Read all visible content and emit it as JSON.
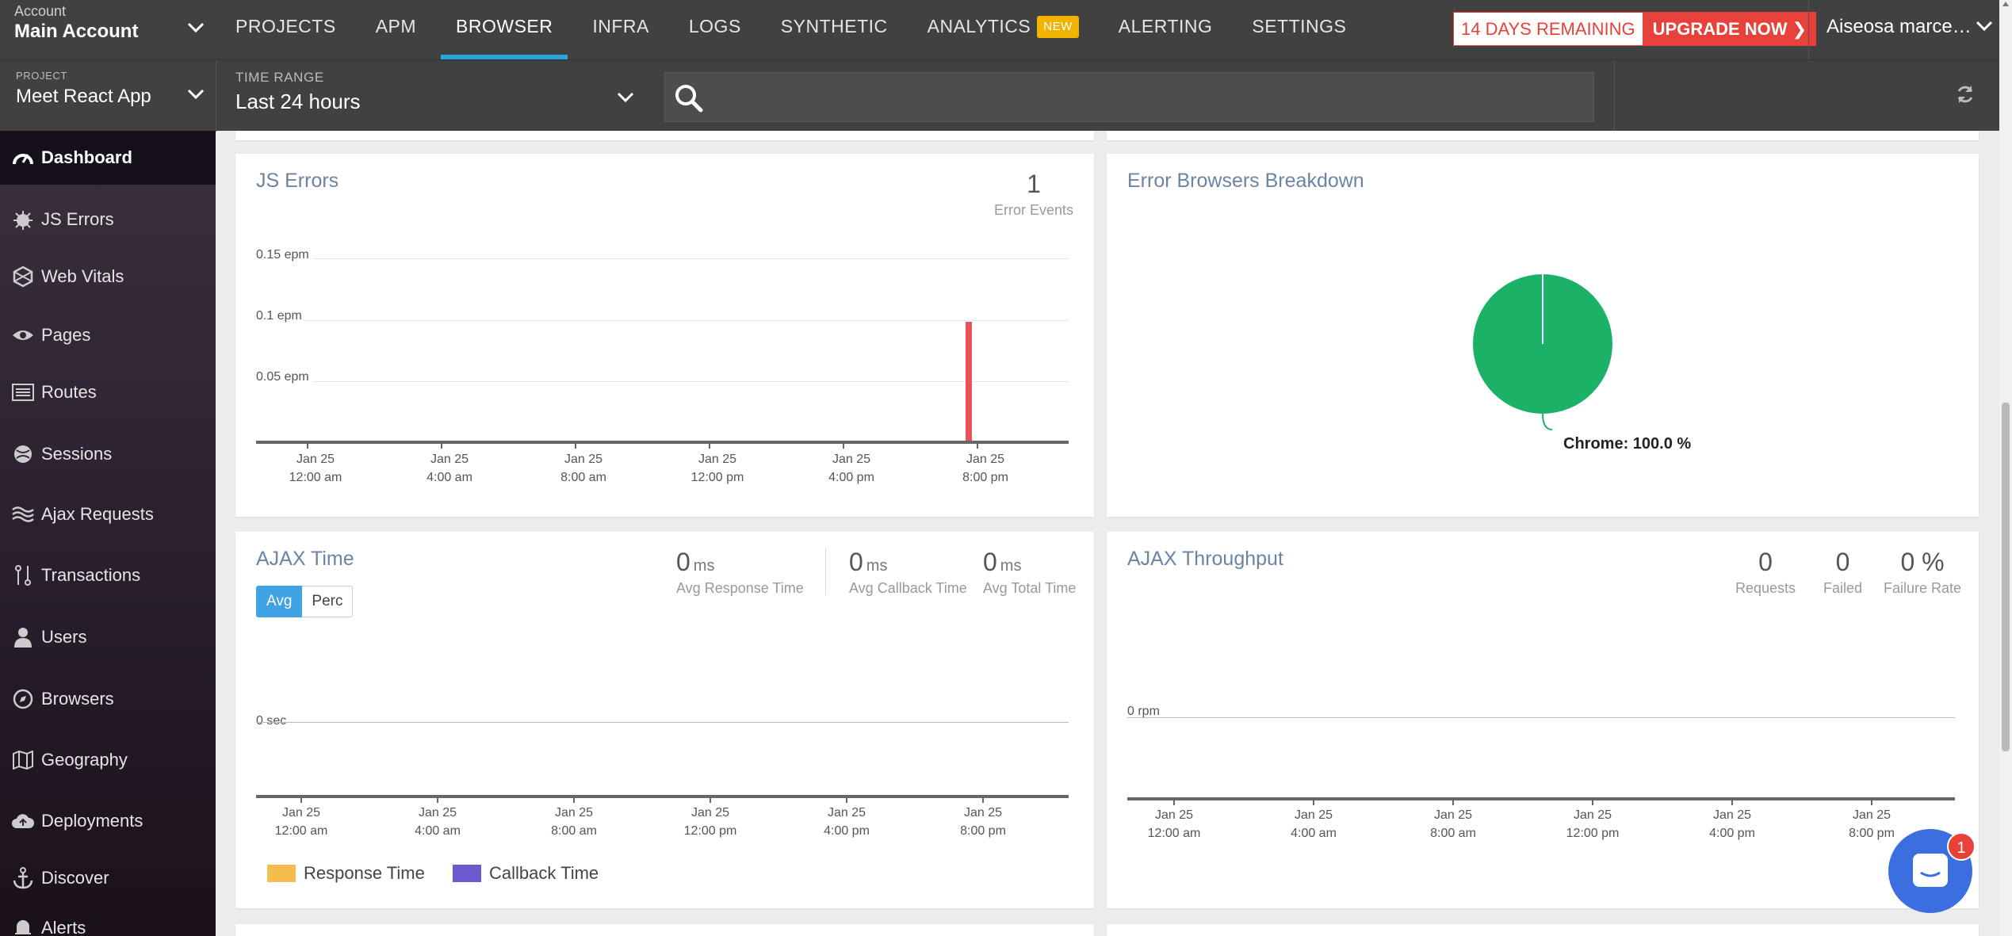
{
  "header": {
    "account_label": "Account",
    "account_name": "Main Account",
    "nav": [
      "PROJECTS",
      "APM",
      "BROWSER",
      "INFRA",
      "LOGS",
      "SYNTHETIC",
      "ANALYTICS",
      "ALERTING",
      "SETTINGS"
    ],
    "analytics_badge": "NEW",
    "trial_text": "14 DAYS REMAINING",
    "upgrade_text": "UPGRADE NOW",
    "user_name": "Aiseosa marce…"
  },
  "subbar": {
    "project_label": "PROJECT",
    "project_name": "Meet React App",
    "time_range_label": "TIME RANGE",
    "time_range_value": "Last 24 hours",
    "search_placeholder": ""
  },
  "sidebar": {
    "items": [
      {
        "label": "Dashboard"
      },
      {
        "label": "JS Errors"
      },
      {
        "label": "Web Vitals"
      },
      {
        "label": "Pages"
      },
      {
        "label": "Routes"
      },
      {
        "label": "Sessions"
      },
      {
        "label": "Ajax Requests"
      },
      {
        "label": "Transactions"
      },
      {
        "label": "Users"
      },
      {
        "label": "Browsers"
      },
      {
        "label": "Geography"
      },
      {
        "label": "Deployments"
      },
      {
        "label": "Discover"
      },
      {
        "label": "Alerts"
      }
    ]
  },
  "js_errors": {
    "title": "JS Errors",
    "count": "1",
    "count_caption": "Error Events",
    "y_labels": [
      "0.15 epm",
      "0.1 epm",
      "0.05 epm"
    ],
    "x_labels": [
      [
        "Jan 25",
        "12:00 am"
      ],
      [
        "Jan 25",
        "4:00 am"
      ],
      [
        "Jan 25",
        "8:00 am"
      ],
      [
        "Jan 25",
        "12:00 pm"
      ],
      [
        "Jan 25",
        "4:00 pm"
      ],
      [
        "Jan 25",
        "8:00 pm"
      ]
    ]
  },
  "browsers_breakdown": {
    "title": "Error Browsers Breakdown",
    "slice_label": "Chrome: 100.0 %"
  },
  "ajax_time": {
    "title": "AJAX Time",
    "toggle": [
      "Avg",
      "Perc"
    ],
    "stats": [
      {
        "value": "0",
        "unit": "ms",
        "caption": "Avg Response Time"
      },
      {
        "value": "0",
        "unit": "ms",
        "caption": "Avg Callback Time"
      },
      {
        "value": "0",
        "unit": "ms",
        "caption": "Avg Total Time"
      }
    ],
    "y_label": "0 sec",
    "x_labels": [
      [
        "Jan 25",
        "12:00 am"
      ],
      [
        "Jan 25",
        "4:00 am"
      ],
      [
        "Jan 25",
        "8:00 am"
      ],
      [
        "Jan 25",
        "12:00 pm"
      ],
      [
        "Jan 25",
        "4:00 pm"
      ],
      [
        "Jan 25",
        "8:00 pm"
      ]
    ],
    "legend": [
      {
        "label": "Response Time",
        "color": "#f5bd4b"
      },
      {
        "label": "Callback Time",
        "color": "#6a5acd"
      }
    ]
  },
  "ajax_throughput": {
    "title": "AJAX Throughput",
    "stats": [
      {
        "value": "0",
        "caption": "Requests"
      },
      {
        "value": "0",
        "caption": "Failed"
      },
      {
        "value": "0 %",
        "caption": "Failure Rate"
      }
    ],
    "y_label": "0 rpm",
    "x_labels": [
      [
        "Jan 25",
        "12:00 am"
      ],
      [
        "Jan 25",
        "4:00 am"
      ],
      [
        "Jan 25",
        "8:00 am"
      ],
      [
        "Jan 25",
        "12:00 pm"
      ],
      [
        "Jan 25",
        "4:00 pm"
      ],
      [
        "Jan 25",
        "8:00 pm"
      ]
    ]
  },
  "chat": {
    "notifications": "1"
  },
  "colors": {
    "accent": "#27a6dc",
    "upgrade": "#e8413a",
    "error_bar": "#e8525a",
    "pie": "#1bb267",
    "new_badge": "#f0b300"
  },
  "chart_data": [
    {
      "type": "bar",
      "title": "JS Errors",
      "ylabel": "epm",
      "ylim": [
        0,
        0.15
      ],
      "series": [
        {
          "values": [
            {
              "x": "Jan 25 ~7:30 pm",
              "y": 0.1
            }
          ]
        }
      ]
    },
    {
      "type": "pie",
      "title": "Error Browsers Breakdown",
      "categories": [
        "Chrome"
      ],
      "values": [
        100.0
      ]
    }
  ]
}
